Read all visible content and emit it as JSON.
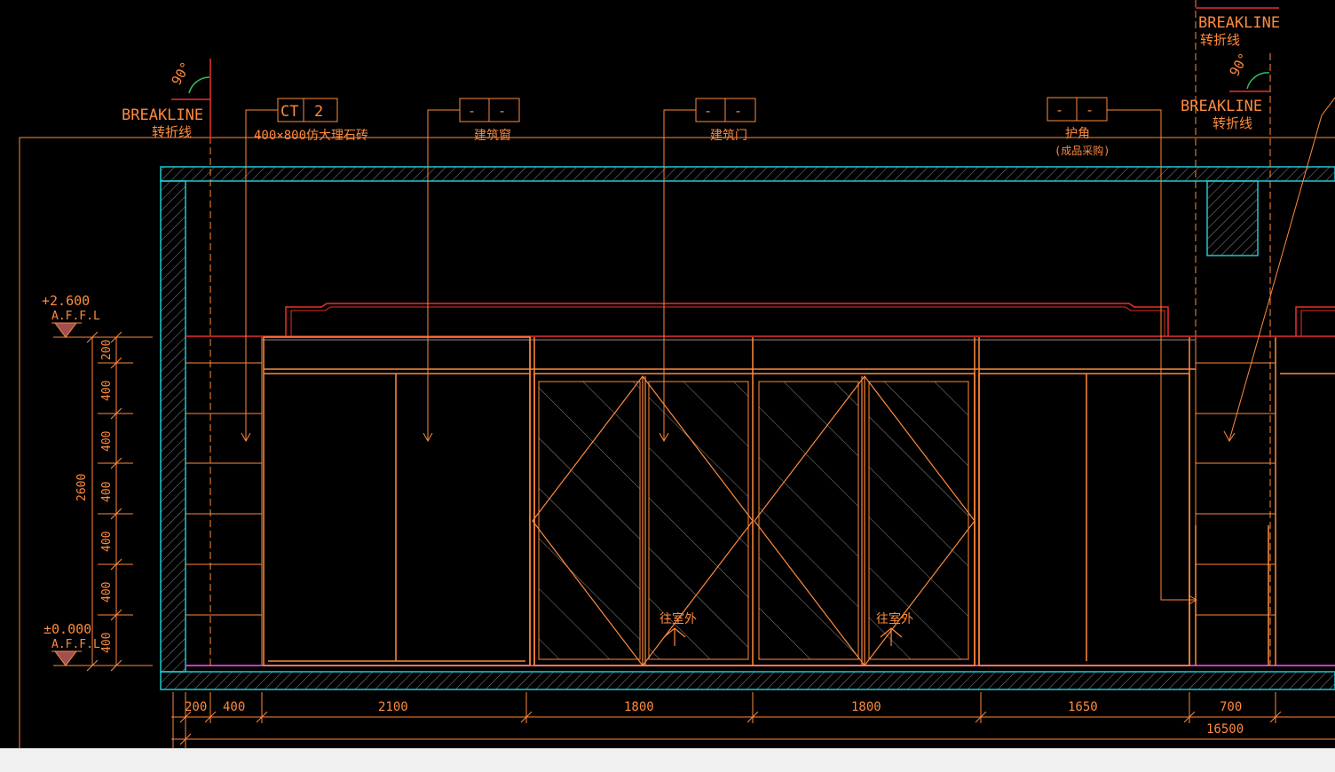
{
  "colors": {
    "background": "#000000",
    "orange": "#ff8a3d",
    "red": "#e8302a",
    "cyan": "#1ec8d2",
    "magenta": "#c838c8",
    "grey": "#8a8a8a",
    "statusbar": "#f0f0f0"
  },
  "breaklines": [
    {
      "angle": "90°",
      "label": "BREAKLINE",
      "label_cn": "转折线"
    },
    {
      "angle": "90°",
      "label": "BREAKLINE",
      "label_cn": "转折线"
    },
    {
      "angle": "",
      "label": "BREAKLINE",
      "label_cn": "转折线"
    }
  ],
  "tags": [
    {
      "code_left": "CT",
      "code_right": "2",
      "desc": "400×800仿大理石砖",
      "desc2": ""
    },
    {
      "code_left": "-",
      "code_right": "-",
      "desc": "建筑窗",
      "desc2": ""
    },
    {
      "code_left": "-",
      "code_right": "-",
      "desc": "建筑门",
      "desc2": ""
    },
    {
      "code_left": "-",
      "code_right": "-",
      "desc": "护角",
      "desc2": "(成品采购)"
    }
  ],
  "levels": [
    {
      "value": "+2.600",
      "unit": "A.F.F.L"
    },
    {
      "value": "±0.000",
      "unit": "A.F.F.L"
    }
  ],
  "vertical_dims": {
    "total": "2600",
    "segments": [
      "200",
      "400",
      "400",
      "400",
      "400",
      "400",
      "400"
    ]
  },
  "horizontal_dims": {
    "segments": [
      "200",
      "400",
      "2100",
      "1800",
      "1800",
      "1650",
      "700"
    ],
    "total": "16500"
  },
  "door_labels": [
    "往室外",
    "往室外"
  ]
}
